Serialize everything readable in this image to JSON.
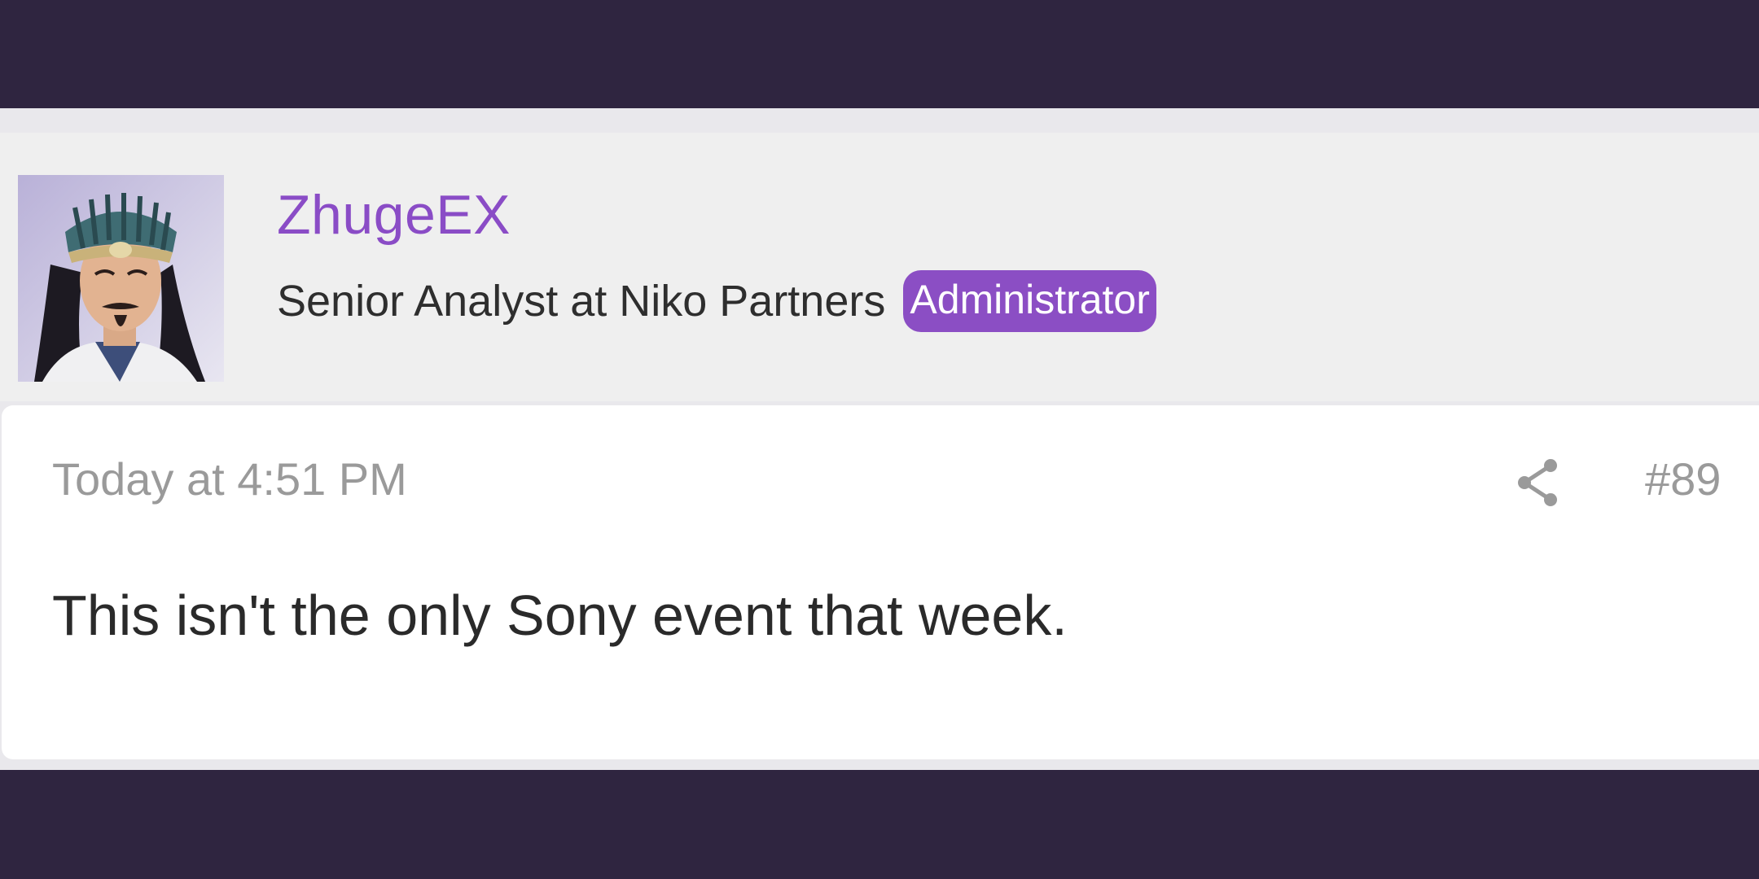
{
  "post": {
    "author": {
      "username": "ZhugeEX",
      "title": "Senior Analyst at Niko Partners",
      "role_badge": "Administrator",
      "avatar_icon": "avatar-portrait"
    },
    "timestamp": "Today at 4:51 PM",
    "post_number": "#89",
    "share_icon": "share-icon",
    "message": "This isn't the only Sony event that week."
  },
  "colors": {
    "background_dark": "#2f2540",
    "accent_purple": "#8b4ec4",
    "username_purple": "#8a4cc6",
    "header_gray": "#efefef",
    "body_white": "#ffffff",
    "meta_gray": "#9a9a9a"
  }
}
